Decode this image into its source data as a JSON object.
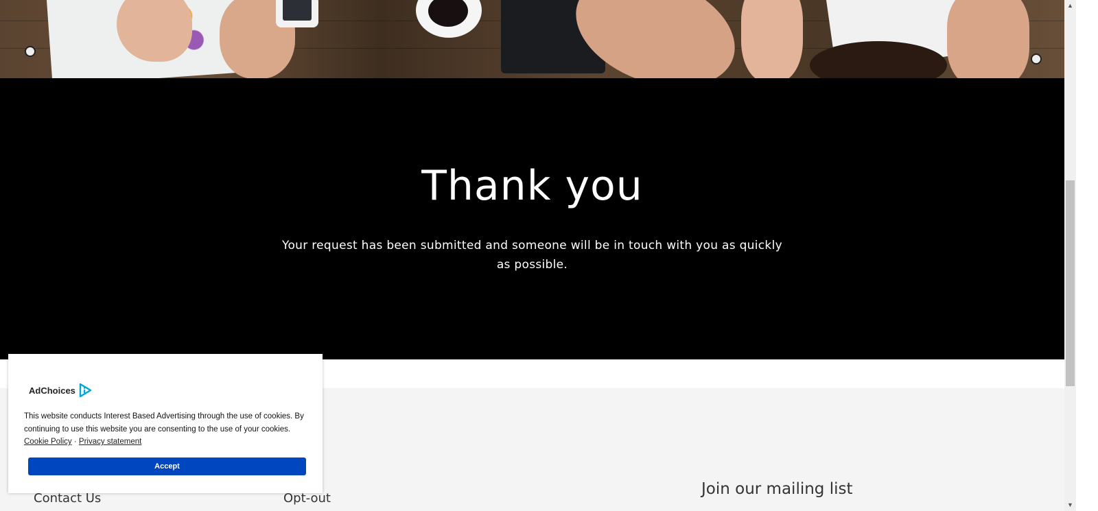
{
  "hero": {
    "image_description_icon": "office-desk-photo"
  },
  "thanks": {
    "title": "Thank you",
    "message": "Your request has been submitted and someone will be in touch with you as quickly as possible."
  },
  "footer": {
    "contact_label": "Contact Us",
    "optout_label": "Opt-out",
    "mailing_title": "Join our mailing list"
  },
  "cookie_banner": {
    "brand": "AdChoices",
    "brand_icon": "adchoices-icon",
    "message": "This website conducts Interest Based Advertising through the use of cookies. By continuing to use this website you are consenting to the use of your cookies.",
    "cookie_policy_link": "Cookie Policy",
    "separator": "·",
    "privacy_link": "Privacy statement",
    "accept_label": "Accept",
    "accent_color": "#0046be"
  },
  "scrollbar": {
    "up_icon": "scroll-up-arrow-icon",
    "down_icon": "scroll-down-arrow-icon"
  }
}
